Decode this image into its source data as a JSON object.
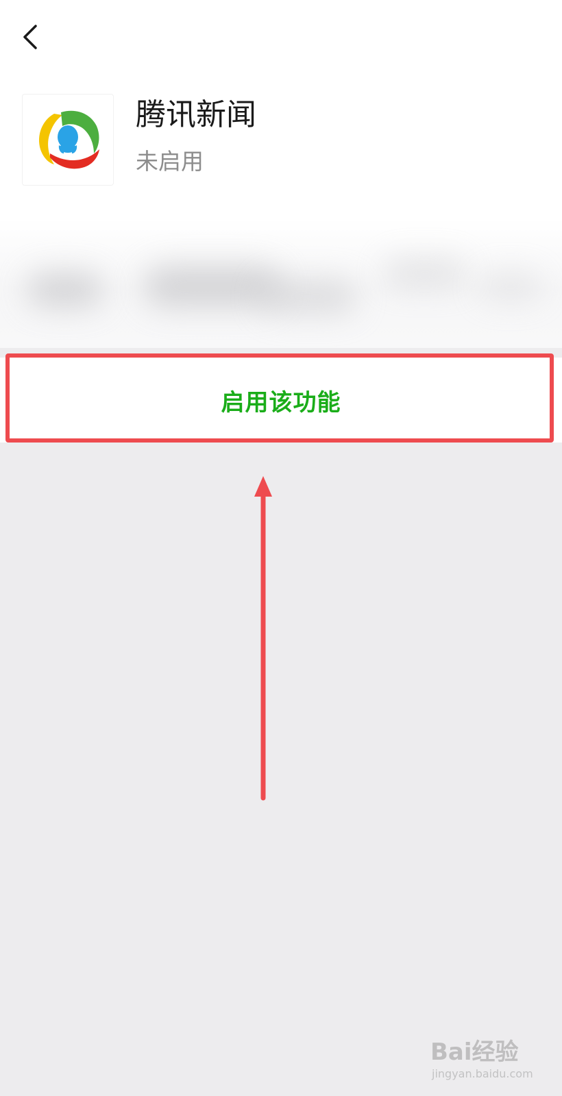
{
  "header": {
    "back_icon": "chevron-left-icon"
  },
  "app": {
    "icon": "tencent-news-logo",
    "name": "腾讯新闻",
    "status": "未启用"
  },
  "action": {
    "enable_label": "启用该功能",
    "accent_color": "#1aad19"
  },
  "annotation": {
    "highlight_color": "#ee4b4f",
    "arrow_direction": "up"
  },
  "watermark": {
    "main": "Bai经验",
    "sub": "jingyan.baidu.com"
  }
}
